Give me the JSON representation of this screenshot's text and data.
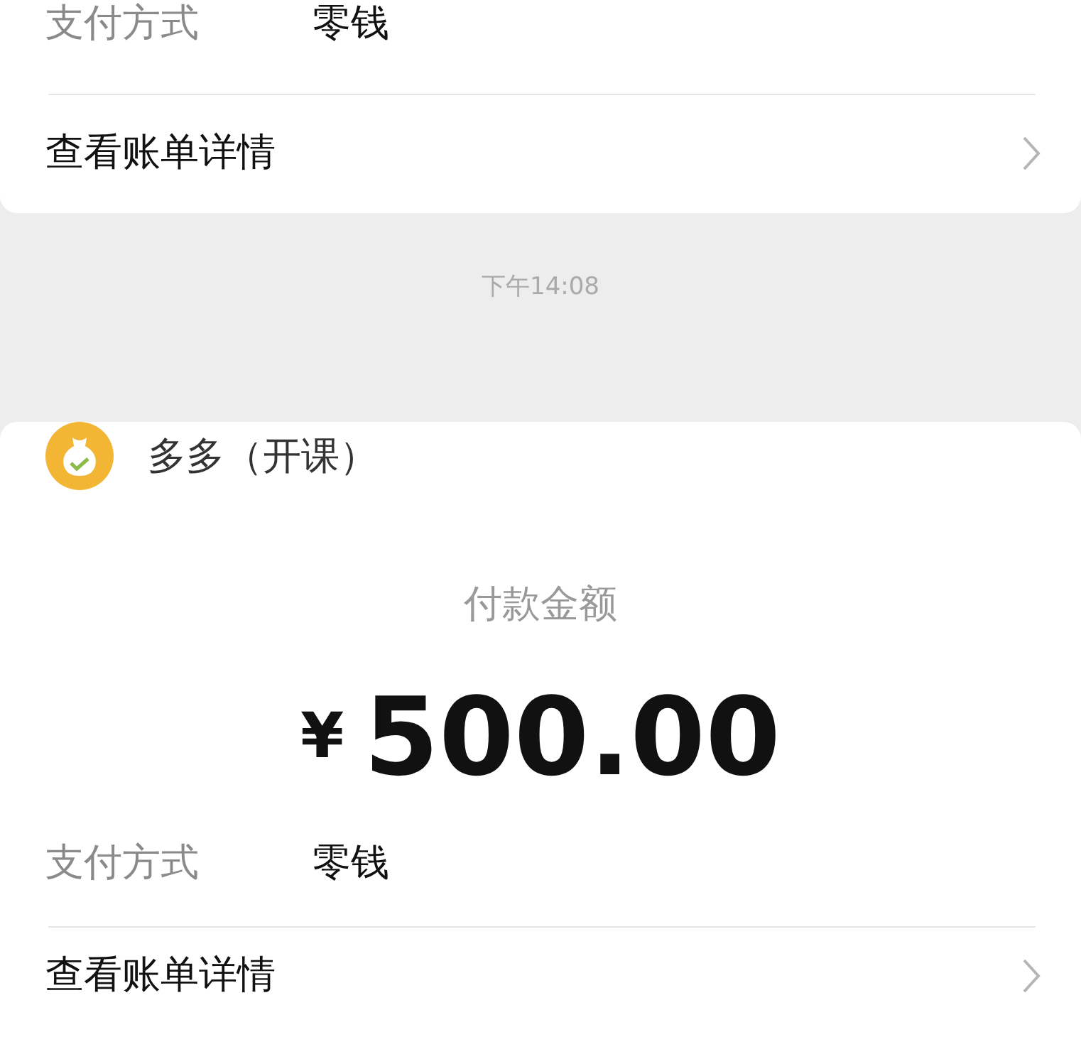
{
  "previous_card": {
    "payment_method_label": "支付方式",
    "payment_method_value": "零钱",
    "details_link": "查看账单详情"
  },
  "timestamp": "下午14:08",
  "payment_card": {
    "merchant": "多多（开课）",
    "amount_label": "付款金额",
    "currency": "¥",
    "amount": "500.00",
    "payment_method_label": "支付方式",
    "payment_method_value": "零钱",
    "details_link": "查看账单详情"
  }
}
